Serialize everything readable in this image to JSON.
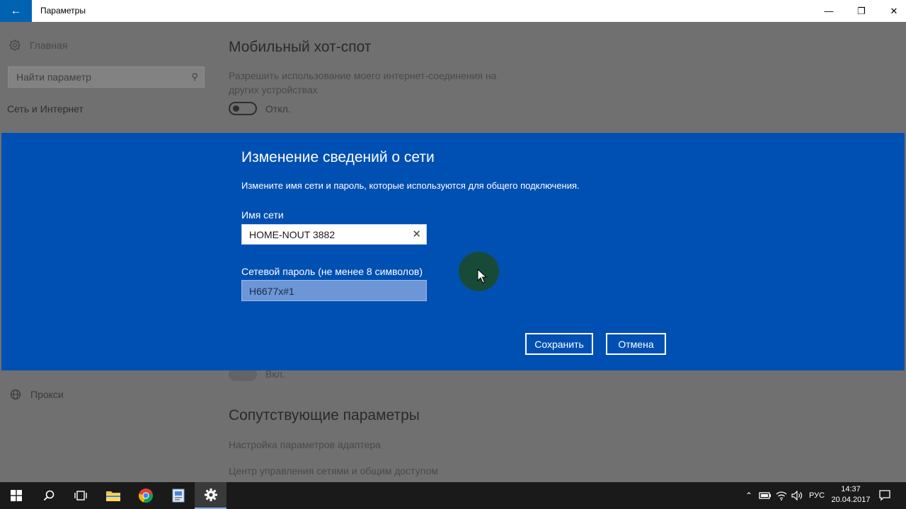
{
  "window": {
    "title": "Параметры",
    "back_icon": "back-arrow-icon",
    "minimize_glyph": "—",
    "maximize_glyph": "❐",
    "close_glyph": "✕"
  },
  "sidebar": {
    "home_label": "Главная",
    "search_placeholder": "Найти параметр",
    "section_label": "Сеть и Интернет",
    "proxy_label": "Прокси"
  },
  "main": {
    "hotspot_title": "Мобильный хот-спот",
    "hotspot_description": "Разрешить использование моего интернет-соединения на других устройствах",
    "hotspot_toggle_state": "Откл.",
    "second_toggle_state": "Вкл.",
    "related_title": "Сопутствующие параметры",
    "link_adapter": "Настройка параметров адаптера",
    "link_network_center": "Центр управления сетями и общим доступом"
  },
  "dialog": {
    "title": "Изменение сведений о сети",
    "description": "Измените имя сети и пароль, которые используются для общего подключения.",
    "network_name_label": "Имя сети",
    "network_name_value": "HOME-NOUT 3882",
    "password_label": "Сетевой пароль (не менее 8 символов)",
    "password_value": "H6677x#1",
    "save_label": "Сохранить",
    "cancel_label": "Отмена",
    "accent_color": "#0050b3"
  },
  "taskbar": {
    "apps": [
      "start-icon",
      "search-icon",
      "task-view-icon",
      "file-explorer-icon",
      "chrome-icon",
      "app-icon",
      "settings-gear-icon"
    ],
    "language": "РУС",
    "time": "14:37",
    "date": "20.04.2017"
  }
}
